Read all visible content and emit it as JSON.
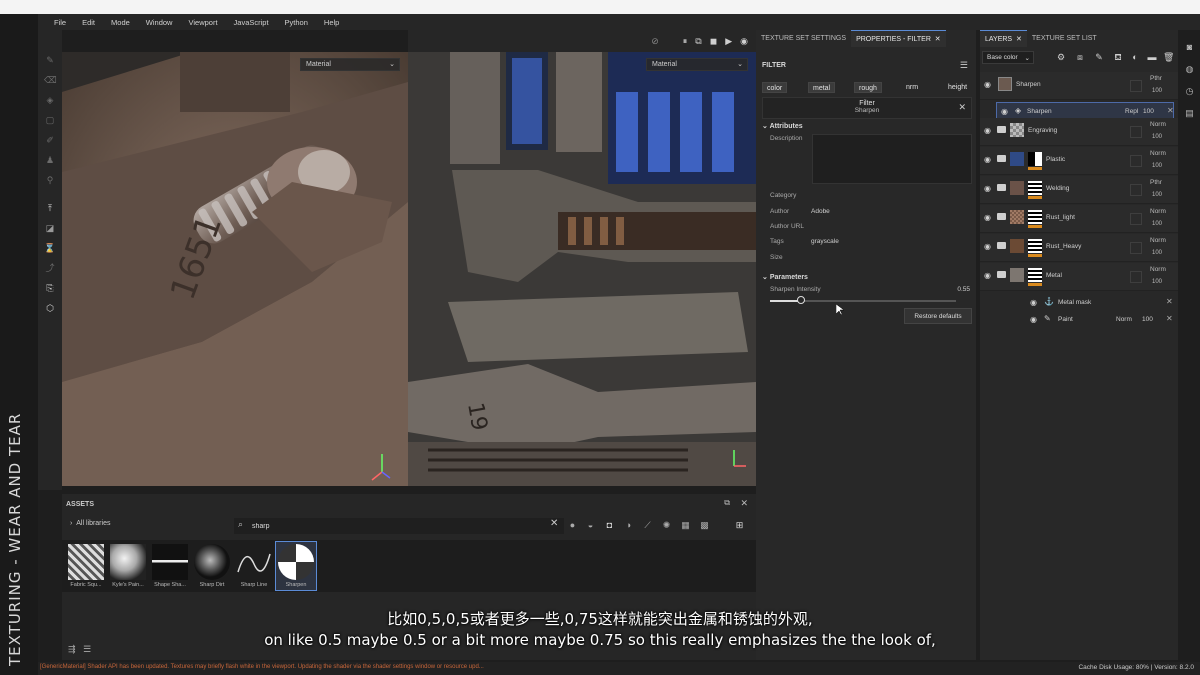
{
  "menu": [
    "File",
    "Edit",
    "Mode",
    "Window",
    "Viewport",
    "JavaScript",
    "Python",
    "Help"
  ],
  "video_title": "TEXTURING - WEAR AND TEAR",
  "viewport": {
    "left_dropdown": "Material",
    "right_dropdown": "Material",
    "left_engraving_text": "1651",
    "right_engraving_text": "19"
  },
  "assets": {
    "title": "ASSETS",
    "libraries_label": "All libraries",
    "search_value": "sharp",
    "items": [
      {
        "label": "Fabric Squ..."
      },
      {
        "label": "Kyle's Pain..."
      },
      {
        "label": "Shape Sha..."
      },
      {
        "label": "Sharp Dirt"
      },
      {
        "label": "Sharp Line"
      },
      {
        "label": "Sharpen"
      }
    ]
  },
  "properties": {
    "tabs": [
      "TEXTURE SET SETTINGS",
      "PROPERTIES - FILTER"
    ],
    "filter_header": "FILTER",
    "channels": [
      "color",
      "metal",
      "rough",
      "nrm",
      "height"
    ],
    "filter_title": "Filter",
    "filter_name": "Sharpen",
    "attributes_header": "Attributes",
    "attributes": {
      "description_label": "Description",
      "category_label": "Category",
      "author_label": "Author",
      "author_value": "Adobe",
      "author_url_label": "Author URL",
      "tags_label": "Tags",
      "tags_value": "grayscale",
      "size_label": "Size"
    },
    "parameters_header": "Parameters",
    "param_name": "Sharpen Intensity",
    "param_value": "0.55",
    "param_fraction": 0.55,
    "restore_label": "Restore defaults"
  },
  "layers": {
    "tabs": [
      "LAYERS",
      "TEXTURE SET LIST"
    ],
    "blend_select": "Base color",
    "items": [
      {
        "name": "Sharpen",
        "mode": "Pthr",
        "opacity": "100"
      },
      {
        "name": "Engraving",
        "mode": "Norm",
        "opacity": "100"
      },
      {
        "name": "Plastic",
        "mode": "Norm",
        "opacity": "100"
      },
      {
        "name": "Welding",
        "mode": "Pthr",
        "opacity": "100"
      },
      {
        "name": "Rust_light",
        "mode": "Norm",
        "opacity": "100"
      },
      {
        "name": "Rust_Heavy",
        "mode": "Norm",
        "opacity": "100"
      },
      {
        "name": "Metal",
        "mode": "Norm",
        "opacity": "100"
      }
    ],
    "sharpen_filter": {
      "name": "Sharpen",
      "mode": "Repl",
      "opacity": "100"
    },
    "metal_mask": {
      "name": "Metal mask"
    },
    "paint": {
      "name": "Paint",
      "mode": "Norm",
      "opacity": "100"
    }
  },
  "status": {
    "message": "[GenericMaterial] Shader API has been updated. Textures may briefly flash white in the viewport. Updating the shader via the shader settings window or resource upd...",
    "cache_label": "Cache Disk Usage:",
    "cache_value": "80%",
    "version": "| Version: 8.2.0"
  },
  "subtitles": {
    "cn": "比如0,5,0,5或者更多一些,0,75这样就能突出金属和锈蚀的外观,",
    "en": "on like 0.5 maybe 0.5 or a bit more maybe 0.75 so this really emphasizes the the look of,"
  },
  "colors": {
    "accent": "#5b8bd6",
    "orange": "#d98a1e",
    "status_warning": "#c8663a"
  }
}
